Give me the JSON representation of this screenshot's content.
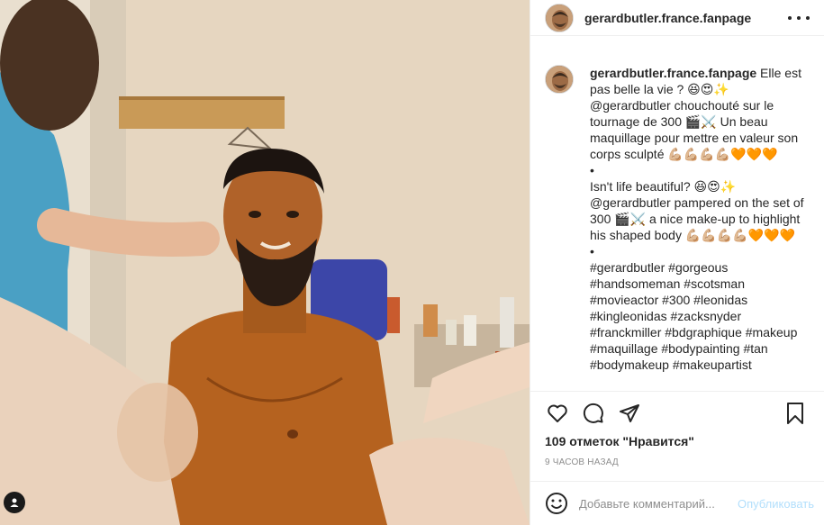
{
  "header": {
    "username": "gerardbutler.france.fanpage",
    "more_icon": "more-horizontal-icon"
  },
  "caption": {
    "username": "gerardbutler.france.fanpage",
    "text": " Elle est pas belle la vie ? 😆😍✨\n@gerardbutler chouchouté sur le tournage de 300 🎬⚔️ Un beau maquillage pour mettre en valeur son corps sculpté 💪🏼💪🏼💪🏼💪🏼🧡🧡🧡\n•\nIsn't life beautiful? 😆😍✨\n@gerardbutler pampered on the set of 300 🎬⚔️ a nice make-up to highlight his shaped body 💪🏼💪🏼💪🏼💪🏼🧡🧡🧡\n•\n#gerardbutler #gorgeous\n#handsomeman #scotsman\n#movieactor #300 #leonidas\n#kingleonidas #zacksnyder\n#franckmiller #bdgraphique #makeup\n#maquillage #bodypainting #tan\n#bodymakeup #makeupartist"
  },
  "actions": {
    "like_icon": "heart-icon",
    "comment_icon": "comment-icon",
    "share_icon": "share-icon",
    "save_icon": "bookmark-icon"
  },
  "likes_text": "109 отметок \"Нравится\"",
  "timestamp": "9 ЧАСОВ НАЗАД",
  "comment": {
    "placeholder": "Добавьте комментарий...",
    "post_label": "Опубликовать",
    "emoji_icon": "smiley-icon"
  },
  "photo": {
    "user_tag_icon": "user-tag-icon"
  }
}
